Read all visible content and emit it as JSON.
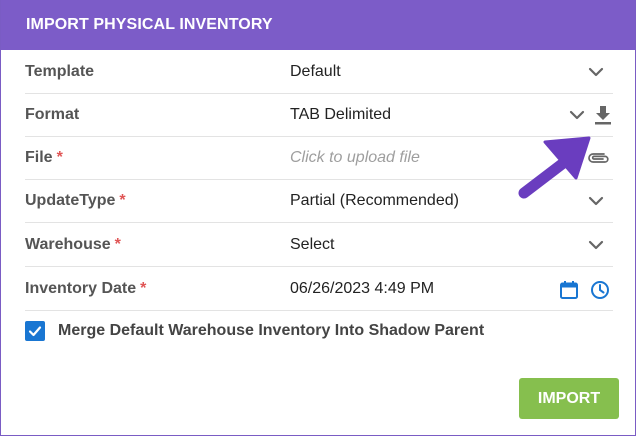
{
  "dialog": {
    "title": "IMPORT PHYSICAL INVENTORY"
  },
  "fields": {
    "template": {
      "label": "Template",
      "value": "Default"
    },
    "format": {
      "label": "Format",
      "value": "TAB Delimited"
    },
    "file": {
      "label": "File",
      "required_mark": "*",
      "placeholder": "Click to upload file"
    },
    "update_type": {
      "label": "UpdateType",
      "required_mark": "*",
      "value": "Partial (Recommended)"
    },
    "warehouse": {
      "label": "Warehouse",
      "required_mark": "*",
      "value": "Select"
    },
    "inventory_date": {
      "label": "Inventory Date",
      "required_mark": "*",
      "value": "06/26/2023 4:49 PM"
    }
  },
  "merge_option": {
    "label": "Merge Default Warehouse Inventory Into Shadow Parent",
    "checked": true
  },
  "actions": {
    "import_label": "IMPORT"
  },
  "icons": {
    "dropdown": "chevron-down-icon",
    "download": "download-icon",
    "attach": "paperclip-icon",
    "calendar": "calendar-icon",
    "clock": "clock-icon",
    "annotation": "pointer-arrow"
  },
  "colors": {
    "header_bg": "#7c5cc8",
    "required": "#e05555",
    "checkbox": "#1976d2",
    "import_button": "#86bf4e",
    "date_icons": "#1976d2",
    "annotation_arrow": "#6a3dbf"
  }
}
